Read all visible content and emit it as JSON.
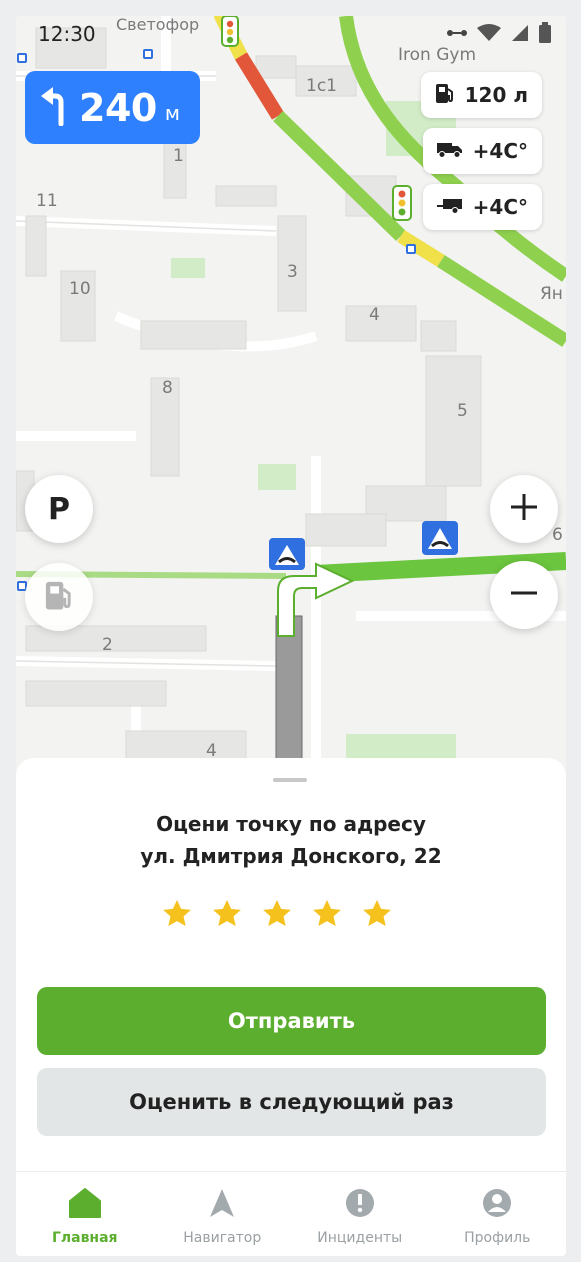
{
  "status_bar": {
    "time": "12:30"
  },
  "map": {
    "labels": {
      "svetofor": "Светофор",
      "iron_gym": "Iron Gym",
      "b_1c1": "1с1",
      "b_1": "1",
      "b_11": "11",
      "b_3": "3",
      "b_10": "10",
      "b_4a": "4",
      "b_8": "8",
      "b_5": "5",
      "b_2": "2",
      "b_4b": "4",
      "b_6": "6",
      "street_partial": "Ян"
    }
  },
  "maneuver": {
    "distance": "240",
    "unit": "м",
    "icon": "turn-left-arrow-icon"
  },
  "chips": {
    "fuel": {
      "icon": "fuel-pump-icon",
      "text": "120 л"
    },
    "truck_temp": {
      "icon": "truck-icon",
      "text": "+4С°"
    },
    "trailer_temp": {
      "icon": "trailer-icon",
      "text": "+4С°"
    }
  },
  "controls": {
    "parking_label": "P"
  },
  "sheet": {
    "title_line1": "Оцени точку по адресу",
    "title_line2": "ул. Дмитрия Донского, 22",
    "rating": 5,
    "rating_max": 5,
    "submit_label": "Отправить",
    "later_label": "Оценить в следующий раз"
  },
  "tabs": [
    {
      "label": "Главная",
      "icon": "home-icon",
      "active": true
    },
    {
      "label": "Навигатор",
      "icon": "navigator-arrow-icon",
      "active": false
    },
    {
      "label": "Инциденты",
      "icon": "alert-icon",
      "active": false
    },
    {
      "label": "Профиль",
      "icon": "profile-icon",
      "active": false
    }
  ],
  "colors": {
    "accent": "#5caf2e",
    "maneuver_blue": "#2f80ff",
    "star": "#f5c11c",
    "traffic_green": "#8fd14f",
    "traffic_yellow": "#f0e04a",
    "traffic_red": "#e2573a"
  }
}
